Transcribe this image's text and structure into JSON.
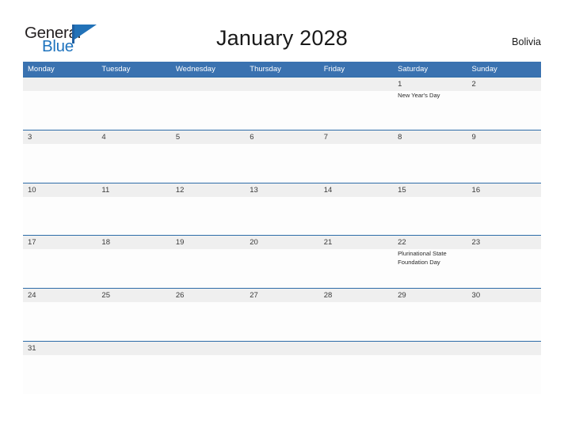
{
  "logo": {
    "word_one": "General",
    "word_two": "Blue",
    "flag_icon": "flag-triangle-icon",
    "color_dark": "#231f20",
    "color_blue": "#1e73be"
  },
  "header": {
    "title": "January 2028",
    "country": "Bolivia"
  },
  "theme": {
    "header_blue": "#3a72b0",
    "row_divider_blue": "#2d6ca8",
    "date_band_gray": "#efefef",
    "cell_white": "#fdfdfd",
    "page_background": "#ffffff"
  },
  "calendar": {
    "month": "January",
    "year": "2028",
    "weekdays": [
      "Monday",
      "Tuesday",
      "Wednesday",
      "Thursday",
      "Friday",
      "Saturday",
      "Sunday"
    ],
    "weeks": [
      {
        "cells": [
          {
            "day": "",
            "event": ""
          },
          {
            "day": "",
            "event": ""
          },
          {
            "day": "",
            "event": ""
          },
          {
            "day": "",
            "event": ""
          },
          {
            "day": "",
            "event": ""
          },
          {
            "day": "1",
            "event": "New Year's Day"
          },
          {
            "day": "2",
            "event": ""
          }
        ]
      },
      {
        "cells": [
          {
            "day": "3",
            "event": ""
          },
          {
            "day": "4",
            "event": ""
          },
          {
            "day": "5",
            "event": ""
          },
          {
            "day": "6",
            "event": ""
          },
          {
            "day": "7",
            "event": ""
          },
          {
            "day": "8",
            "event": ""
          },
          {
            "day": "9",
            "event": ""
          }
        ]
      },
      {
        "cells": [
          {
            "day": "10",
            "event": ""
          },
          {
            "day": "11",
            "event": ""
          },
          {
            "day": "12",
            "event": ""
          },
          {
            "day": "13",
            "event": ""
          },
          {
            "day": "14",
            "event": ""
          },
          {
            "day": "15",
            "event": ""
          },
          {
            "day": "16",
            "event": ""
          }
        ]
      },
      {
        "cells": [
          {
            "day": "17",
            "event": ""
          },
          {
            "day": "18",
            "event": ""
          },
          {
            "day": "19",
            "event": ""
          },
          {
            "day": "20",
            "event": ""
          },
          {
            "day": "21",
            "event": ""
          },
          {
            "day": "22",
            "event": "Plurinational State Foundation Day"
          },
          {
            "day": "23",
            "event": ""
          }
        ]
      },
      {
        "cells": [
          {
            "day": "24",
            "event": ""
          },
          {
            "day": "25",
            "event": ""
          },
          {
            "day": "26",
            "event": ""
          },
          {
            "day": "27",
            "event": ""
          },
          {
            "day": "28",
            "event": ""
          },
          {
            "day": "29",
            "event": ""
          },
          {
            "day": "30",
            "event": ""
          }
        ]
      },
      {
        "cells": [
          {
            "day": "31",
            "event": ""
          },
          {
            "day": "",
            "event": ""
          },
          {
            "day": "",
            "event": ""
          },
          {
            "day": "",
            "event": ""
          },
          {
            "day": "",
            "event": ""
          },
          {
            "day": "",
            "event": ""
          },
          {
            "day": "",
            "event": ""
          }
        ]
      }
    ]
  }
}
